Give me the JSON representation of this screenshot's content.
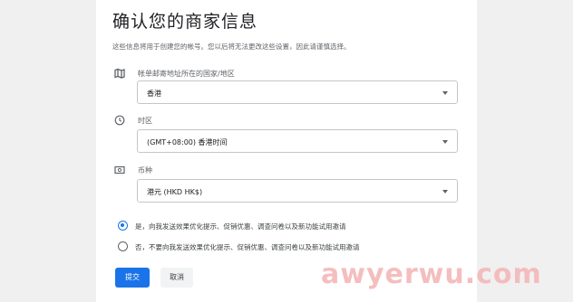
{
  "page": {
    "title": "确认您的商家信息",
    "subtitle": "这些信息将用于创建您的帐号。您以后将无法更改这些设置，因此请谨慎选择。"
  },
  "fields": {
    "country": {
      "label": "帐单邮寄地址所在的国家/地区",
      "value": "香港",
      "icon": "map-icon"
    },
    "timezone": {
      "label": "时区",
      "value": "(GMT+08:00) 香港时间",
      "icon": "clock-icon"
    },
    "currency": {
      "label": "币种",
      "value": "港元 (HKD HK$)",
      "icon": "currency-icon"
    }
  },
  "email_preference": {
    "selected": "yes",
    "options": [
      {
        "id": "yes",
        "label": "是，向我发送效果优化提示、促销优惠、调查问卷以及新功能试用邀请"
      },
      {
        "id": "no",
        "label": "否，不要向我发送效果优化提示、促销优惠、调查问卷以及新功能试用邀请"
      }
    ]
  },
  "actions": {
    "submit_label": "提交",
    "cancel_label": "取消"
  },
  "watermark": "awyerwu.com",
  "colors": {
    "accent": "#1a73e8",
    "watermark": "#f4b8b8"
  }
}
